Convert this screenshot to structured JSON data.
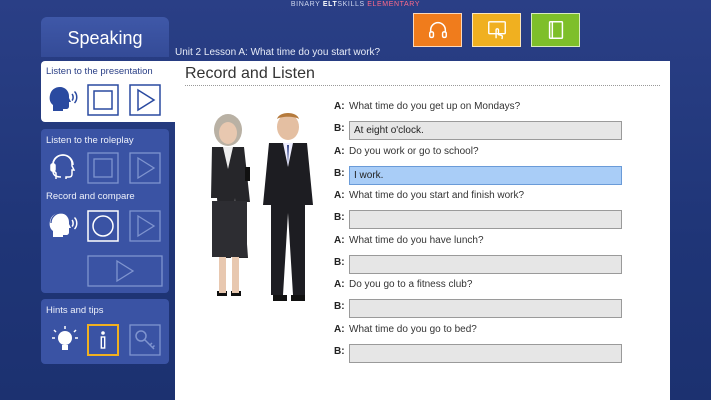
{
  "brand": {
    "part1": "BINARY ",
    "part2": "ELT",
    "part3": "SKILLS ",
    "part4": "ELEMENTARY"
  },
  "toolbar": {
    "buttons": [
      {
        "name": "audio-button",
        "icon": "headphones-icon",
        "color": "#f07c1c"
      },
      {
        "name": "help-button",
        "icon": "hand-pointer-icon",
        "color": "#f0b020"
      },
      {
        "name": "notes-button",
        "icon": "notebook-icon",
        "color": "#7ebf2a"
      }
    ]
  },
  "section_title": "Speaking",
  "lesson_title": "Unit 2 Lesson A: What time do you start work?",
  "sidebar": {
    "presentation_label": "Listen to the presentation",
    "roleplay_label": "Listen to the roleplay",
    "record_label": "Record and compare",
    "hints_label": "Hints and tips"
  },
  "main": {
    "title": "Record and Listen",
    "dialogue": [
      {
        "speaker_a": "A:",
        "question": "What time do you get up on Mondays?",
        "speaker_b": "B:",
        "answer": "At eight o'clock.",
        "active": false
      },
      {
        "speaker_a": "A:",
        "question": "Do you work or go to school?",
        "speaker_b": "B:",
        "answer": "I work.",
        "active": true
      },
      {
        "speaker_a": "A:",
        "question": "What time do you start and finish work?",
        "speaker_b": "B:",
        "answer": "",
        "active": false
      },
      {
        "speaker_a": "A:",
        "question": "What time do you have lunch?",
        "speaker_b": "B:",
        "answer": "",
        "active": false
      },
      {
        "speaker_a": "A:",
        "question": "Do you go to a fitness club?",
        "speaker_b": "B:",
        "answer": "",
        "active": false
      },
      {
        "speaker_a": "A:",
        "question": "What time do you go to bed?",
        "speaker_b": "B:",
        "answer": "",
        "active": false
      }
    ]
  }
}
